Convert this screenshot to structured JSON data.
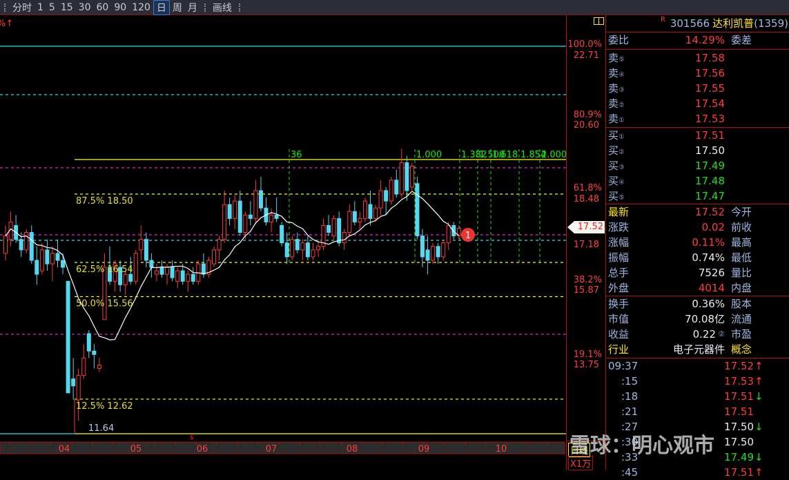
{
  "toolbar": {
    "items": [
      "分时",
      "1",
      "5",
      "15",
      "30",
      "60",
      "90",
      "120",
      "日",
      "周",
      "月"
    ],
    "active": "日",
    "draw": "画线"
  },
  "chart": {
    "top_label": "%↑",
    "low_label": "11.64",
    "marker": "$",
    "event_badge": "1",
    "fib_labels": [
      {
        "text": "87.5% 18.50",
        "price": 18.5
      },
      {
        "text": "62.5% 16.54",
        "price": 16.54
      },
      {
        "text": "50.0% 15.56",
        "price": 15.56
      },
      {
        "text": "12.5% 12.62",
        "price": 12.62
      }
    ],
    "time_fib": [
      "36",
      "1.000",
      "1.382",
      "1.500",
      "1.618",
      "1.854",
      "2.000"
    ],
    "months": [
      "04",
      "05",
      "06",
      "07",
      "08",
      "09",
      "10"
    ],
    "right_axis": [
      {
        "pct": "100.0%",
        "price": "22.71"
      },
      {
        "pct": "80.9%",
        "price": "20.60"
      },
      {
        "pct": "61.8%",
        "price": "18.48"
      },
      {
        "pct": "",
        "price": "17.18"
      },
      {
        "pct": "38.2%",
        "price": "15.87"
      },
      {
        "pct": "19.1%",
        "price": "13.75"
      }
    ],
    "current_price": "17.52",
    "period_label": "日线",
    "volume_unit": "X1万",
    "colors": {
      "up": "#ff3c3c",
      "down": "#54d8f0",
      "ma": "#ffffff",
      "fib": "#ffff00",
      "magenta": "#e020e0",
      "cyan": "#20e0f0",
      "green": "#11ee11"
    },
    "candles": [
      [
        16.8,
        17.6,
        16.6,
        17.3
      ],
      [
        17.2,
        18.0,
        17.0,
        17.7
      ],
      [
        17.6,
        17.9,
        17.1,
        17.2
      ],
      [
        17.2,
        17.4,
        16.7,
        16.9
      ],
      [
        16.9,
        17.5,
        16.8,
        17.4
      ],
      [
        17.4,
        17.6,
        16.5,
        16.6
      ],
      [
        16.6,
        17.0,
        15.9,
        16.2
      ],
      [
        16.3,
        17.1,
        16.2,
        16.9
      ],
      [
        16.9,
        17.2,
        16.3,
        16.5
      ],
      [
        16.5,
        17.0,
        16.0,
        16.8
      ],
      [
        16.8,
        17.2,
        16.4,
        16.6
      ],
      [
        16.6,
        16.8,
        16.2,
        16.4
      ],
      [
        16.0,
        16.0,
        12.8,
        12.8
      ],
      [
        13.2,
        13.8,
        12.6,
        13.0
      ],
      [
        12.6,
        13.5,
        12.0,
        13.3
      ],
      [
        13.3,
        14.2,
        13.2,
        13.8
      ],
      [
        14.5,
        14.6,
        13.8,
        14.0
      ],
      [
        14.0,
        14.2,
        13.5,
        13.9
      ],
      [
        13.5,
        13.8,
        13.4,
        13.6
      ],
      [
        14.9,
        16.8,
        14.9,
        16.4
      ],
      [
        16.4,
        17.0,
        15.9,
        16.0
      ],
      [
        16.0,
        16.6,
        15.7,
        16.5
      ],
      [
        16.4,
        16.6,
        15.7,
        15.9
      ],
      [
        15.9,
        16.3,
        15.6,
        16.2
      ],
      [
        16.2,
        16.7,
        15.9,
        16.0
      ],
      [
        16.0,
        16.9,
        15.9,
        16.8
      ],
      [
        16.9,
        17.6,
        16.6,
        17.2
      ],
      [
        17.2,
        17.4,
        16.4,
        16.6
      ],
      [
        16.6,
        16.8,
        16.1,
        16.4
      ],
      [
        16.2,
        16.5,
        16.0,
        16.3
      ],
      [
        16.4,
        16.6,
        16.1,
        16.2
      ],
      [
        16.2,
        16.5,
        15.9,
        16.4
      ],
      [
        16.4,
        16.6,
        16.0,
        16.1
      ],
      [
        16.0,
        16.4,
        15.8,
        16.3
      ],
      [
        16.3,
        16.5,
        15.9,
        16.0
      ],
      [
        16.0,
        16.3,
        15.7,
        16.2
      ],
      [
        16.2,
        16.4,
        15.9,
        16.0
      ],
      [
        16.0,
        16.6,
        15.9,
        16.5
      ],
      [
        16.5,
        16.8,
        16.1,
        16.2
      ],
      [
        16.2,
        16.7,
        16.1,
        16.6
      ],
      [
        16.5,
        17.0,
        16.4,
        16.9
      ],
      [
        16.9,
        17.3,
        16.6,
        17.2
      ],
      [
        17.2,
        18.6,
        17.1,
        18.2
      ],
      [
        18.2,
        18.4,
        17.6,
        17.8
      ],
      [
        17.8,
        18.5,
        17.5,
        18.3
      ],
      [
        18.3,
        18.6,
        17.3,
        17.4
      ],
      [
        17.4,
        18.0,
        17.2,
        17.9
      ],
      [
        17.9,
        18.3,
        17.6,
        17.8
      ],
      [
        17.8,
        18.9,
        17.7,
        18.6
      ],
      [
        18.6,
        19.0,
        18.0,
        18.1
      ],
      [
        18.1,
        18.4,
        17.6,
        17.7
      ],
      [
        17.7,
        18.1,
        17.4,
        17.9
      ],
      [
        17.9,
        18.4,
        17.7,
        17.8
      ],
      [
        17.6,
        17.7,
        17.0,
        17.1
      ],
      [
        17.1,
        17.4,
        16.5,
        16.7
      ],
      [
        16.7,
        17.3,
        16.6,
        17.2
      ],
      [
        17.2,
        17.4,
        16.8,
        16.9
      ],
      [
        16.9,
        17.2,
        16.6,
        17.1
      ],
      [
        17.1,
        17.3,
        16.6,
        16.7
      ],
      [
        16.7,
        17.1,
        16.6,
        16.9
      ],
      [
        16.9,
        17.2,
        16.7,
        17.0
      ],
      [
        17.0,
        17.8,
        16.9,
        17.6
      ],
      [
        17.6,
        17.9,
        17.3,
        17.4
      ],
      [
        17.3,
        17.9,
        17.2,
        17.8
      ],
      [
        17.8,
        18.0,
        17.0,
        17.1
      ],
      [
        17.1,
        17.5,
        16.9,
        17.4
      ],
      [
        17.4,
        18.2,
        17.3,
        18.0
      ],
      [
        18.0,
        18.3,
        17.6,
        17.7
      ],
      [
        17.7,
        18.0,
        17.5,
        17.8
      ],
      [
        17.8,
        18.4,
        17.7,
        18.3
      ],
      [
        18.2,
        18.6,
        17.6,
        17.8
      ],
      [
        17.8,
        18.2,
        17.7,
        18.1
      ],
      [
        18.1,
        18.9,
        17.9,
        18.6
      ],
      [
        18.6,
        18.7,
        17.9,
        18.3
      ],
      [
        18.3,
        19.0,
        18.2,
        18.9
      ],
      [
        18.9,
        19.2,
        18.4,
        18.5
      ],
      [
        18.5,
        19.8,
        18.4,
        19.4
      ],
      [
        19.4,
        19.6,
        18.3,
        18.6
      ],
      [
        18.7,
        19.4,
        18.6,
        19.3
      ],
      [
        18.8,
        19.0,
        17.2,
        17.3
      ],
      [
        17.3,
        17.5,
        16.4,
        16.7
      ],
      [
        16.9,
        17.3,
        16.2,
        16.6
      ],
      [
        16.6,
        17.1,
        16.5,
        17.0
      ],
      [
        17.0,
        17.1,
        16.5,
        16.7
      ],
      [
        16.7,
        17.2,
        16.6,
        17.1
      ],
      [
        17.1,
        17.7,
        16.9,
        17.6
      ],
      [
        17.6,
        17.7,
        17.2,
        17.3
      ],
      [
        17.3,
        17.6,
        17.2,
        17.52
      ]
    ]
  },
  "quote": {
    "flag": "R",
    "code": "301566",
    "name": "达利凯普",
    "count": "(1359)",
    "weibi_label": "委比",
    "weibi": "14.29%",
    "weicha_label": "委差",
    "sells": [
      {
        "label": "卖",
        "n": "⑤",
        "price": "17.58"
      },
      {
        "label": "卖",
        "n": "④",
        "price": "17.56"
      },
      {
        "label": "卖",
        "n": "③",
        "price": "17.55"
      },
      {
        "label": "卖",
        "n": "②",
        "price": "17.54"
      },
      {
        "label": "卖",
        "n": "①",
        "price": "17.53"
      }
    ],
    "buys": [
      {
        "label": "买",
        "n": "①",
        "price": "17.51",
        "c": "red"
      },
      {
        "label": "买",
        "n": "②",
        "price": "17.50",
        "c": "white"
      },
      {
        "label": "买",
        "n": "③",
        "price": "17.49",
        "c": "green"
      },
      {
        "label": "买",
        "n": "④",
        "price": "17.48",
        "c": "green"
      },
      {
        "label": "买",
        "n": "⑤",
        "price": "17.47",
        "c": "green"
      }
    ],
    "stats": [
      {
        "l": "最新",
        "v": "17.52",
        "r": "今开",
        "lc": "yellow",
        "vc": "red"
      },
      {
        "l": "涨跌",
        "v": "0.02",
        "r": "前收",
        "lc": "blue",
        "vc": "red"
      },
      {
        "l": "涨幅",
        "v": "0.11%",
        "r": "最高",
        "lc": "blue",
        "vc": "red"
      },
      {
        "l": "振幅",
        "v": "0.74%",
        "r": "最低",
        "lc": "blue",
        "vc": "white"
      },
      {
        "l": "总手",
        "v": "7526",
        "r": "量比",
        "lc": "blue",
        "vc": "white"
      },
      {
        "l": "外盘",
        "v": "4014",
        "r": "内盘",
        "lc": "blue",
        "vc": "red"
      }
    ],
    "stats2": [
      {
        "l": "换手",
        "v": "0.36%",
        "r": "股本",
        "lc": "blue",
        "vc": "white",
        "rc": "blue"
      },
      {
        "l": "市值",
        "v": "70.08亿",
        "r": "流通",
        "lc": "blue",
        "vc": "white",
        "rc": "blue"
      },
      {
        "l": "收益",
        "v": "0.22",
        "sup": "②",
        "r": "市盈",
        "lc": "blue",
        "vc": "white",
        "rc": "blue"
      },
      {
        "l": "行业",
        "v": "电子元器件",
        "r": "概念",
        "lc": "yellow",
        "vc": "white",
        "rc": "yellow"
      }
    ],
    "ticks": [
      {
        "t": "09:37",
        "p": "17.52",
        "a": "↑",
        "pc": "red",
        "ac": "red"
      },
      {
        "t": ":15",
        "p": "17.53",
        "a": "↑",
        "pc": "red",
        "ac": "red"
      },
      {
        "t": ":18",
        "p": "17.51",
        "a": "↓",
        "pc": "red",
        "ac": "green"
      },
      {
        "t": ":21",
        "p": "17.51",
        "a": "",
        "pc": "red",
        "ac": "red"
      },
      {
        "t": ":27",
        "p": "17.50",
        "a": "↓",
        "pc": "white",
        "ac": "green"
      },
      {
        "t": ":30",
        "p": "17.50",
        "a": "",
        "pc": "white",
        "ac": "white"
      },
      {
        "t": ":33",
        "p": "17.49",
        "a": "↓",
        "pc": "green",
        "ac": "green"
      },
      {
        "t": ":45",
        "p": "17.51",
        "a": "↑",
        "pc": "red",
        "ac": "red"
      }
    ]
  },
  "watermark": "雪球：明心观市"
}
